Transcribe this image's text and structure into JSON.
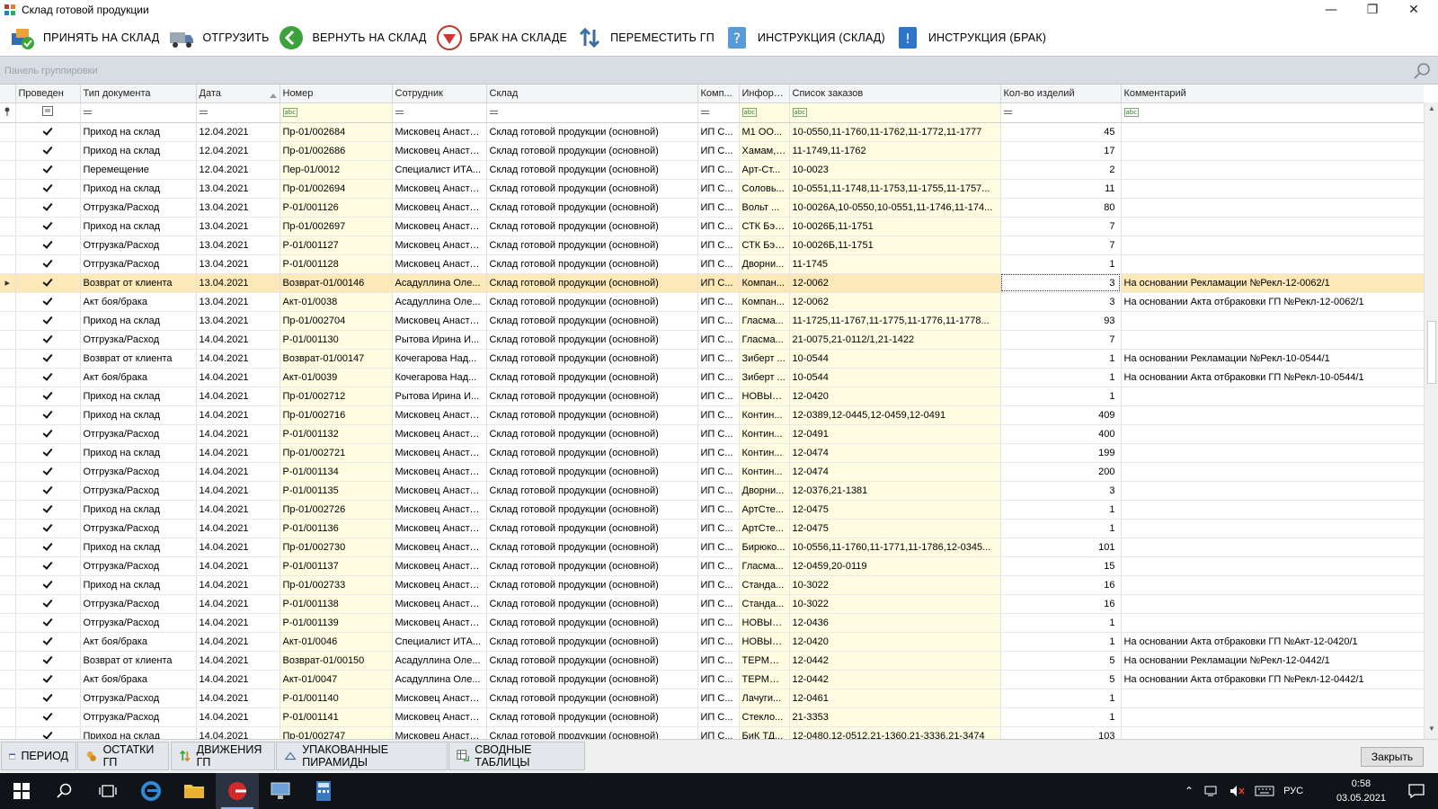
{
  "window": {
    "title": "Склад готовой продукции",
    "minimize": "—",
    "maximize": "❐",
    "close": "✕"
  },
  "toolbar": [
    {
      "label": "ПРИНЯТЬ НА СКЛАД",
      "icon": "boxes-accept-icon"
    },
    {
      "label": "ОТГРУЗИТЬ",
      "icon": "truck-icon"
    },
    {
      "label": "ВЕРНУТЬ НА СКЛАД",
      "icon": "arrow-left-green-icon"
    },
    {
      "label": "БРАК НА СКЛАДЕ",
      "icon": "defect-red-triangle-icon"
    },
    {
      "label": "ПЕРЕМЕСТИТЬ ГП",
      "icon": "arrows-updown-icon"
    },
    {
      "label": "ИНСТРУКЦИЯ (СКЛАД)",
      "icon": "help-book-icon"
    },
    {
      "label": "ИНСТРУКЦИЯ (БРАК)",
      "icon": "help-book-icon"
    }
  ],
  "group_panel": {
    "hint": "Панель группировки"
  },
  "columns": [
    "Проведен",
    "Тип документа",
    "Дата",
    "Номер",
    "Сотрудник",
    "Склад",
    "Комп...",
    "Информ...",
    "Список заказов",
    "Кол-во изделий",
    "Комментарий"
  ],
  "rows": [
    {
      "type": "Приход на склад",
      "date": "12.04.2021",
      "num": "Пр-01/002684",
      "emp": "Мисковец Анаста...",
      "wh": "Склад готовой продукции (основной)",
      "comp": "ИП С...",
      "info": "М1 ОО...",
      "orders": "10-0550,11-1760,11-1762,11-1772,11-1777",
      "qty": "45",
      "comment": ""
    },
    {
      "type": "Приход на склад",
      "date": "12.04.2021",
      "num": "Пр-01/002686",
      "emp": "Мисковец Анаста...",
      "wh": "Склад готовой продукции (основной)",
      "comp": "ИП С...",
      "info": "Хамам, ...",
      "orders": "11-1749,11-1762",
      "qty": "17",
      "comment": ""
    },
    {
      "type": "Перемещение",
      "date": "12.04.2021",
      "num": "Пер-01/0012",
      "emp": "Специалист ИТА...",
      "wh": "Склад готовой продукции (основной)",
      "comp": "ИП С...",
      "info": "Арт-Ст...",
      "orders": "10-0023",
      "qty": "2",
      "comment": ""
    },
    {
      "type": "Приход на склад",
      "date": "13.04.2021",
      "num": "Пр-01/002694",
      "emp": "Мисковец Анаста...",
      "wh": "Склад готовой продукции (основной)",
      "comp": "ИП С...",
      "info": "Соловь...",
      "orders": "10-0551,11-1748,11-1753,11-1755,11-1757...",
      "qty": "11",
      "comment": ""
    },
    {
      "type": "Отгрузка/Расход",
      "date": "13.04.2021",
      "num": "Р-01/001126",
      "emp": "Мисковец Анаста...",
      "wh": "Склад готовой продукции (основной)",
      "comp": "ИП С...",
      "info": "Вольт ...",
      "orders": "10-0026А,10-0550,10-0551,11-1746,11-174...",
      "qty": "80",
      "comment": ""
    },
    {
      "type": "Приход на склад",
      "date": "13.04.2021",
      "num": "Пр-01/002697",
      "emp": "Мисковец Анаста...",
      "wh": "Склад готовой продукции (основной)",
      "comp": "ИП С...",
      "info": "СТК Бэс...",
      "orders": "10-0026Б,11-1751",
      "qty": "7",
      "comment": ""
    },
    {
      "type": "Отгрузка/Расход",
      "date": "13.04.2021",
      "num": "Р-01/001127",
      "emp": "Мисковец Анаста...",
      "wh": "Склад готовой продукции (основной)",
      "comp": "ИП С...",
      "info": "СТК Бэс...",
      "orders": "10-0026Б,11-1751",
      "qty": "7",
      "comment": ""
    },
    {
      "type": "Отгрузка/Расход",
      "date": "13.04.2021",
      "num": "Р-01/001128",
      "emp": "Мисковец Анаста...",
      "wh": "Склад готовой продукции (основной)",
      "comp": "ИП С...",
      "info": "Дворни...",
      "orders": "11-1745",
      "qty": "1",
      "comment": ""
    },
    {
      "type": "Возврат от клиента",
      "date": "13.04.2021",
      "num": "Возврат-01/00146",
      "emp": "Асадуллина Оле...",
      "wh": "Склад готовой продукции (основной)",
      "comp": "ИП С...",
      "info": "Компан...",
      "orders": "12-0062",
      "qty": "3",
      "comment": "На основании Рекламации №Рекл-12-0062/1",
      "selected": true
    },
    {
      "type": "Акт боя/брака",
      "date": "13.04.2021",
      "num": "Акт-01/0038",
      "emp": "Асадуллина Оле...",
      "wh": "Склад готовой продукции (основной)",
      "comp": "ИП С...",
      "info": "Компан...",
      "orders": "12-0062",
      "qty": "3",
      "comment": "На основании Акта отбраковки ГП №Рекл-12-0062/1"
    },
    {
      "type": "Приход на склад",
      "date": "13.04.2021",
      "num": "Пр-01/002704",
      "emp": "Мисковец Анаста...",
      "wh": "Склад готовой продукции (основной)",
      "comp": "ИП С...",
      "info": "Гласма...",
      "orders": "11-1725,11-1767,11-1775,11-1776,11-1778...",
      "qty": "93",
      "comment": ""
    },
    {
      "type": "Отгрузка/Расход",
      "date": "14.04.2021",
      "num": "Р-01/001130",
      "emp": "Рытова Ирина И...",
      "wh": "Склад готовой продукции (основной)",
      "comp": "ИП С...",
      "info": "Гласма...",
      "orders": "21-0075,21-0112/1,21-1422",
      "qty": "7",
      "comment": ""
    },
    {
      "type": "Возврат от клиента",
      "date": "14.04.2021",
      "num": "Возврат-01/00147",
      "emp": "Кочегарова Над...",
      "wh": "Склад готовой продукции (основной)",
      "comp": "ИП С...",
      "info": "Зиберт ...",
      "orders": "10-0544",
      "qty": "1",
      "comment": "На основании Рекламации №Рекл-10-0544/1"
    },
    {
      "type": "Акт боя/брака",
      "date": "14.04.2021",
      "num": "Акт-01/0039",
      "emp": "Кочегарова Над...",
      "wh": "Склад готовой продукции (основной)",
      "comp": "ИП С...",
      "info": "Зиберт ...",
      "orders": "10-0544",
      "qty": "1",
      "comment": "На основании Акта отбраковки ГП №Рекл-10-0544/1"
    },
    {
      "type": "Приход на склад",
      "date": "14.04.2021",
      "num": "Пр-01/002712",
      "emp": "Рытова Ирина И...",
      "wh": "Склад готовой продукции (основной)",
      "comp": "ИП С...",
      "info": "НОВЫЕ ...",
      "orders": "12-0420",
      "qty": "1",
      "comment": ""
    },
    {
      "type": "Приход на склад",
      "date": "14.04.2021",
      "num": "Пр-01/002716",
      "emp": "Мисковец Анаста...",
      "wh": "Склад готовой продукции (основной)",
      "comp": "ИП С...",
      "info": "Контин...",
      "orders": "12-0389,12-0445,12-0459,12-0491",
      "qty": "409",
      "comment": ""
    },
    {
      "type": "Отгрузка/Расход",
      "date": "14.04.2021",
      "num": "Р-01/001132",
      "emp": "Мисковец Анаста...",
      "wh": "Склад готовой продукции (основной)",
      "comp": "ИП С...",
      "info": "Контин...",
      "orders": "12-0491",
      "qty": "400",
      "comment": ""
    },
    {
      "type": "Приход на склад",
      "date": "14.04.2021",
      "num": "Пр-01/002721",
      "emp": "Мисковец Анаста...",
      "wh": "Склад готовой продукции (основной)",
      "comp": "ИП С...",
      "info": "Контин...",
      "orders": "12-0474",
      "qty": "199",
      "comment": ""
    },
    {
      "type": "Отгрузка/Расход",
      "date": "14.04.2021",
      "num": "Р-01/001134",
      "emp": "Мисковец Анаста...",
      "wh": "Склад готовой продукции (основной)",
      "comp": "ИП С...",
      "info": "Контин...",
      "orders": "12-0474",
      "qty": "200",
      "comment": ""
    },
    {
      "type": "Отгрузка/Расход",
      "date": "14.04.2021",
      "num": "Р-01/001135",
      "emp": "Мисковец Анаста...",
      "wh": "Склад готовой продукции (основной)",
      "comp": "ИП С...",
      "info": "Дворни...",
      "orders": "12-0376,21-1381",
      "qty": "3",
      "comment": ""
    },
    {
      "type": "Приход на склад",
      "date": "14.04.2021",
      "num": "Пр-01/002726",
      "emp": "Мисковец Анаста...",
      "wh": "Склад готовой продукции (основной)",
      "comp": "ИП С...",
      "info": "АртСте...",
      "orders": "12-0475",
      "qty": "1",
      "comment": ""
    },
    {
      "type": "Отгрузка/Расход",
      "date": "14.04.2021",
      "num": "Р-01/001136",
      "emp": "Мисковец Анаста...",
      "wh": "Склад готовой продукции (основной)",
      "comp": "ИП С...",
      "info": "АртСте...",
      "orders": "12-0475",
      "qty": "1",
      "comment": ""
    },
    {
      "type": "Приход на склад",
      "date": "14.04.2021",
      "num": "Пр-01/002730",
      "emp": "Мисковец Анаста...",
      "wh": "Склад готовой продукции (основной)",
      "comp": "ИП С...",
      "info": "Бирюко...",
      "orders": "10-0556,11-1760,11-1771,11-1786,12-0345...",
      "qty": "101",
      "comment": ""
    },
    {
      "type": "Отгрузка/Расход",
      "date": "14.04.2021",
      "num": "Р-01/001137",
      "emp": "Мисковец Анаста...",
      "wh": "Склад готовой продукции (основной)",
      "comp": "ИП С...",
      "info": "Гласма...",
      "orders": "12-0459,20-0119",
      "qty": "15",
      "comment": ""
    },
    {
      "type": "Приход на склад",
      "date": "14.04.2021",
      "num": "Пр-01/002733",
      "emp": "Мисковец Анаста...",
      "wh": "Склад готовой продукции (основной)",
      "comp": "ИП С...",
      "info": "Станда...",
      "orders": "10-3022",
      "qty": "16",
      "comment": ""
    },
    {
      "type": "Отгрузка/Расход",
      "date": "14.04.2021",
      "num": "Р-01/001138",
      "emp": "Мисковец Анаста...",
      "wh": "Склад готовой продукции (основной)",
      "comp": "ИП С...",
      "info": "Станда...",
      "orders": "10-3022",
      "qty": "16",
      "comment": ""
    },
    {
      "type": "Отгрузка/Расход",
      "date": "14.04.2021",
      "num": "Р-01/001139",
      "emp": "Мисковец Анаста...",
      "wh": "Склад готовой продукции (основной)",
      "comp": "ИП С...",
      "info": "НОВЫЕ ...",
      "orders": "12-0436",
      "qty": "1",
      "comment": ""
    },
    {
      "type": "Акт боя/брака",
      "date": "14.04.2021",
      "num": "Акт-01/0046",
      "emp": "Специалист ИТА...",
      "wh": "Склад готовой продукции (основной)",
      "comp": "ИП С...",
      "info": "НОВЫЕ ...",
      "orders": "12-0420",
      "qty": "1",
      "comment": "На основании Акта отбраковки ГП №Акт-12-0420/1"
    },
    {
      "type": "Возврат от клиента",
      "date": "14.04.2021",
      "num": "Возврат-01/00150",
      "emp": "Асадуллина Оле...",
      "wh": "Склад готовой продукции (основной)",
      "comp": "ИП С...",
      "info": "ТЕРМЭК...",
      "orders": "12-0442",
      "qty": "5",
      "comment": "На основании Рекламации №Рекл-12-0442/1"
    },
    {
      "type": "Акт боя/брака",
      "date": "14.04.2021",
      "num": "Акт-01/0047",
      "emp": "Асадуллина Оле...",
      "wh": "Склад готовой продукции (основной)",
      "comp": "ИП С...",
      "info": "ТЕРМЭК...",
      "orders": "12-0442",
      "qty": "5",
      "comment": "На основании Акта отбраковки ГП №Рекл-12-0442/1"
    },
    {
      "type": "Отгрузка/Расход",
      "date": "14.04.2021",
      "num": "Р-01/001140",
      "emp": "Мисковец Анаста...",
      "wh": "Склад готовой продукции (основной)",
      "comp": "ИП С...",
      "info": "Лачуги...",
      "orders": "12-0461",
      "qty": "1",
      "comment": ""
    },
    {
      "type": "Отгрузка/Расход",
      "date": "14.04.2021",
      "num": "Р-01/001141",
      "emp": "Мисковец Анаста...",
      "wh": "Склад готовой продукции (основной)",
      "comp": "ИП С...",
      "info": "Стекло...",
      "orders": "21-3353",
      "qty": "1",
      "comment": ""
    },
    {
      "type": "Приход на склад",
      "date": "14.04.2021",
      "num": "Пр-01/002747",
      "emp": "Мисковец Анаста...",
      "wh": "Склад готовой продукции (основной)",
      "comp": "ИП С...",
      "info": "БиК ТД...",
      "orders": "12-0480,12-0512,21-1360,21-3336,21-3474",
      "qty": "103",
      "comment": ""
    }
  ],
  "bottom_tabs": [
    {
      "label": "ПЕРИОД",
      "icon": "calendar-icon"
    },
    {
      "label": "ОСТАТКИ ГП",
      "icon": "coins-icon"
    },
    {
      "label": "ДВИЖЕНИЯ ГП",
      "icon": "movement-arrows-icon"
    },
    {
      "label": "УПАКОВАННЫЕ ПИРАМИДЫ",
      "icon": "pyramid-icon"
    },
    {
      "label": "СВОДНЫЕ ТАБЛИЦЫ",
      "icon": "pivot-table-icon"
    }
  ],
  "close_button": "Закрыть",
  "taskbar": {
    "lang": "РУС",
    "time": "0:58",
    "date": "03.05.2021"
  },
  "colors": {
    "selected_row": "#fde8b8",
    "filter_yellow": "#fffde1",
    "group_panel": "#d8dde3",
    "taskbar": "#101318"
  }
}
